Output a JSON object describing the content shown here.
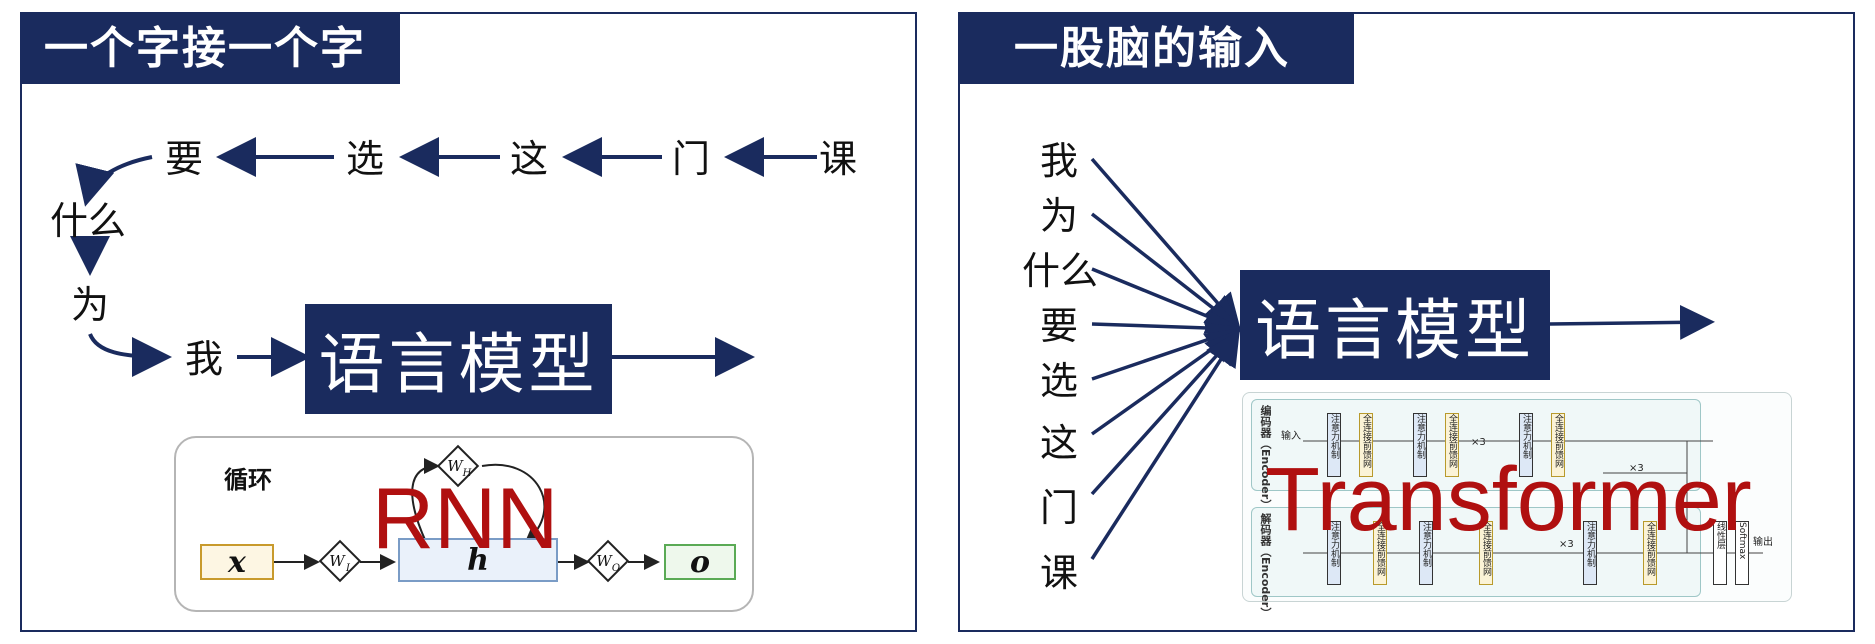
{
  "left_panel": {
    "title": "一个字接一个字",
    "sequence": [
      "课",
      "门",
      "这",
      "选",
      "要",
      "什么",
      "为",
      "我"
    ],
    "model_label": "语言模型",
    "rnn": {
      "caption": "循环",
      "input": "x",
      "hidden": "h",
      "output": "o",
      "w_i": "W",
      "w_i_sub": "I",
      "w_h": "W",
      "w_h_sub": "H",
      "w_o": "W",
      "w_o_sub": "O",
      "overlay": "RNN"
    },
    "colors": {
      "accent": "#1a2b5e",
      "rnn_red": "#b01010",
      "x_border": "#c89a2c",
      "h_border": "#7a9cc6",
      "o_border": "#5aaa55"
    }
  },
  "right_panel": {
    "title": "一股脑的输入",
    "inputs": [
      "我",
      "为",
      "什么",
      "要",
      "选",
      "这",
      "门",
      "课"
    ],
    "model_label": "语言模型",
    "transformer": {
      "overlay": "Transformer",
      "encoder_label": "编码器（Encoder）",
      "decoder_label": "解码器（Encoder）",
      "input_label": "输入",
      "output_label": "输出",
      "repeat_1": "×3",
      "repeat_2": "×3",
      "repeat_3": "×3",
      "attn_block": "注意力机制",
      "ffn_block": "全连接前馈网络",
      "linear_block": "线性层",
      "softmax_block": "Softmax"
    }
  }
}
